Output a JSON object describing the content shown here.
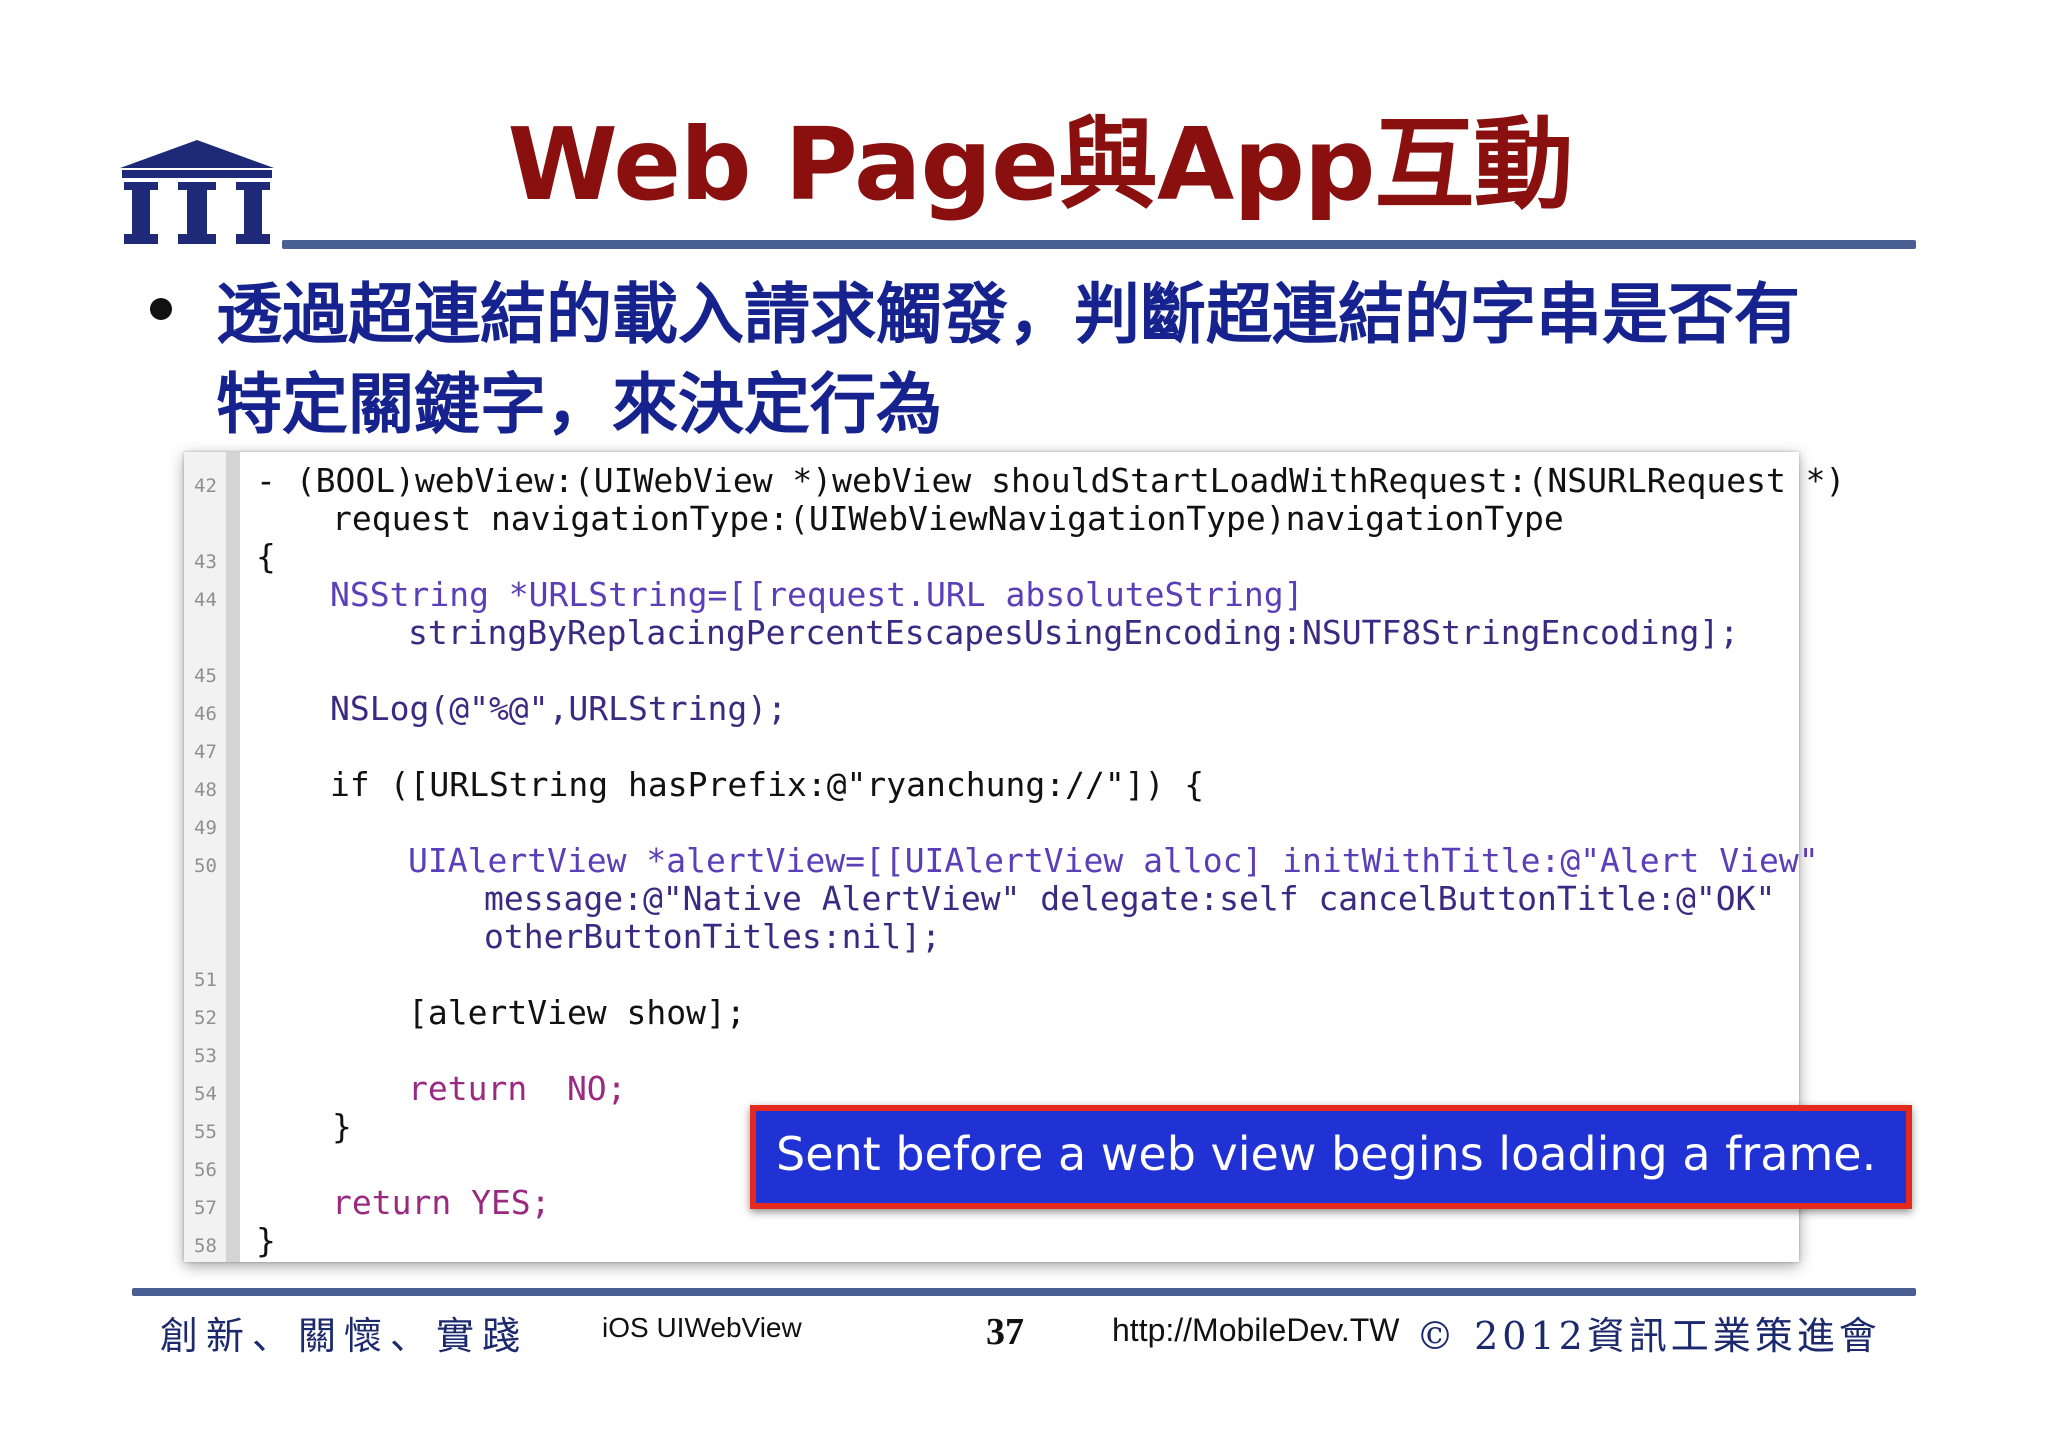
{
  "slide": {
    "title": "Web Page與App互動",
    "bullet": "透過超連結的載入請求觸發，判斷超連結的字串是否有特定關鍵字，來決定行為"
  },
  "code": {
    "line_numbers": [
      "42",
      "43",
      "44",
      "45",
      "46",
      "47",
      "48",
      "49",
      "50",
      "51",
      "52",
      "53",
      "54",
      "55",
      "56",
      "57",
      "58"
    ],
    "lines": [
      "- (BOOL)webView:(UIWebView *)webView shouldStartLoadWithRequest:(NSURLRequest *)",
      "request navigationType:(UIWebViewNavigationType)navigationType",
      "{",
      "NSString *URLString=[[request.URL absoluteString]",
      "stringByReplacingPercentEscapesUsingEncoding:NSUTF8StringEncoding];",
      "NSLog(@\"%@\",URLString);",
      "if ([URLString hasPrefix:@\"ryanchung://\"]) {",
      "UIAlertView *alertView=[[UIAlertView alloc] initWithTitle:@\"Alert View\"",
      "message:@\"Native AlertView\" delegate:self cancelButtonTitle:@\"OK\"",
      "otherButtonTitles:nil];",
      "[alertView show];",
      "return  NO;",
      "}",
      "return YES;",
      "}"
    ]
  },
  "callout": {
    "text": "Sent before a web view begins loading a frame."
  },
  "footer": {
    "motto": "創新、關懷、實踐",
    "topic": "iOS UIWebView",
    "page": "37",
    "url": "http://MobileDev.TW",
    "copyright": "© 2012資訊工業策進會"
  },
  "colors": {
    "title": "#8a1010",
    "bullet": "#16238f",
    "rule": "#4a5f91",
    "callout_bg": "#2032d4",
    "callout_border": "#e42a1c",
    "keyword": "#9a2a80",
    "type": "#5a3fb8",
    "string": "#c2261a"
  },
  "icons": {
    "logo": "iii-institute-logo"
  }
}
